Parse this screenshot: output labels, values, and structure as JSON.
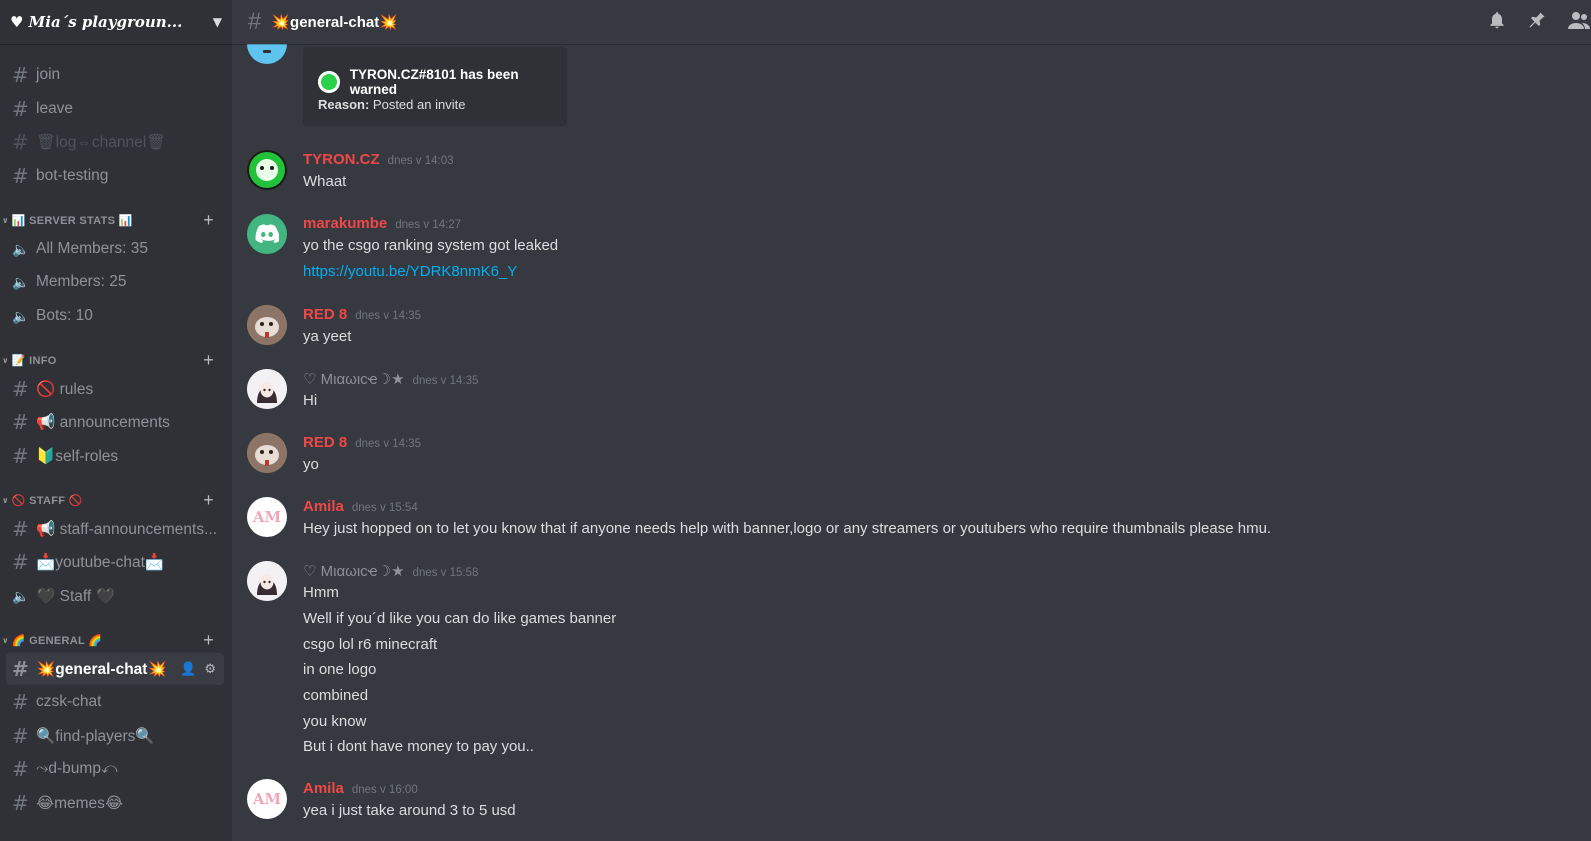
{
  "server": {
    "name": "♥ Mia´s playgroun...",
    "chevron": "chevron-down-icon"
  },
  "channels": [
    {
      "name": "join",
      "kind": "text"
    },
    {
      "name": "leave",
      "kind": "text"
    },
    {
      "name": "🗑log⇔channel🗑",
      "kind": "text",
      "muted": true
    },
    {
      "name": "bot-testing",
      "kind": "text"
    }
  ],
  "categories": {
    "server_stats": {
      "label": "📊 SERVER STATS 📊",
      "channels": [
        "All Members: 35",
        "Members: 25",
        "Bots: 10"
      ]
    },
    "info": {
      "label": "📝 INFO",
      "channels": [
        "🚫 rules",
        "📢 announcements",
        "🔰self-roles"
      ]
    },
    "staff": {
      "label": "🚫 STAFF 🚫",
      "channels": [
        "📢 staff-announcements...",
        "📩youtube-chat📩",
        "🖤 Staff 🖤"
      ]
    },
    "general": {
      "label": "🌈 GENERAL 🌈",
      "channels": [
        "💥general-chat💥",
        "czsk-chat",
        "🔍find-players🔍",
        "⤳d-bump⤺",
        "😂memes😂"
      ]
    }
  },
  "topbar": {
    "channel_title": "💥general-chat💥"
  },
  "embed": {
    "title": "TYRON.CZ#8101 has been warned",
    "reason_label": "Reason:",
    "reason_text": "Posted an invite"
  },
  "messages": [
    {
      "author": "TYRON.CZ",
      "time": "dnes v 14:03",
      "lines": [
        "Whaat"
      ]
    },
    {
      "author": "marakumbe",
      "time": "dnes v 14:27",
      "lines": [
        "yo the csgo ranking system got leaked"
      ],
      "link": "https://youtu.be/YDRK8nmK6_Y"
    },
    {
      "author": "RED 8",
      "time": "dnes v 14:35",
      "lines": [
        "ya yeet"
      ]
    },
    {
      "author": "♡ Mιαωιcҽ☽★",
      "time": "dnes v 14:35",
      "lines": [
        "Hi"
      ]
    },
    {
      "author": "RED 8",
      "time": "dnes v 14:35",
      "lines": [
        "yo"
      ]
    },
    {
      "author": "Amila",
      "time": "dnes v 15:54",
      "lines": [
        "Hey just hopped on to let you know that if anyone needs help with banner,logo or any streamers or youtubers who require thumbnails please hmu."
      ]
    },
    {
      "author": "♡ Mιαωιcҽ☽★",
      "time": "dnes v 15:58",
      "lines": [
        "Hmm",
        "Well if you´d like you can do like games banner",
        "csgo lol r6  minecraft",
        "in one logo",
        "combined",
        "you know",
        "But i dont have money to pay you.."
      ]
    },
    {
      "author": "Amila",
      "time": "dnes v 16:00",
      "lines": [
        "yea i just take around 3 to 5 usd"
      ]
    }
  ],
  "avatars": {
    "amila_initials": "AM"
  },
  "colors": {
    "sidebar": "#2f3136",
    "chat": "#36393f",
    "red_name": "#f04747",
    "link": "#00b0f4",
    "discord_green": "#43b581"
  }
}
